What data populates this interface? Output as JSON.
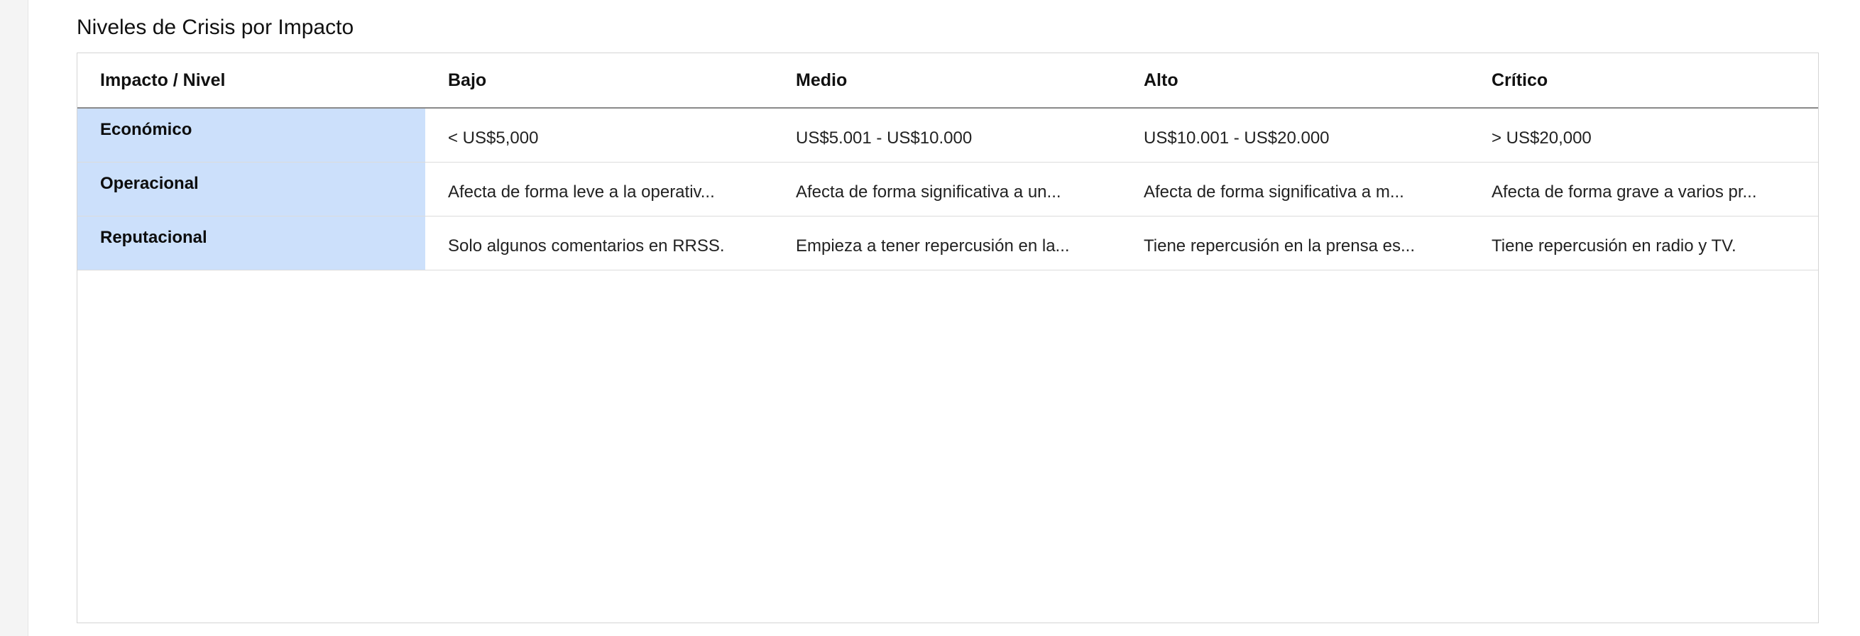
{
  "page": {
    "title": "Niveles de Crisis por Impacto"
  },
  "table": {
    "headers": [
      "Impacto / Nivel",
      "Bajo",
      "Medio",
      "Alto",
      "Crítico"
    ],
    "rows": [
      {
        "label": "Económico",
        "cells": [
          "< US$5,000",
          "US$5.001 - US$10.000",
          "US$10.001 - US$20.000",
          "> US$20,000"
        ]
      },
      {
        "label": "Operacional",
        "cells": [
          "Afecta de forma leve a la operativ...",
          "Afecta de forma significativa a un...",
          "Afecta de forma significativa a m...",
          "Afecta de forma grave a varios pr..."
        ]
      },
      {
        "label": "Reputacional",
        "cells": [
          "Solo algunos comentarios en RRSS.",
          "Empieza a tener repercusión en la...",
          "Tiene repercusión en la prensa es...",
          "Tiene repercusión en radio y TV."
        ]
      }
    ]
  },
  "colors": {
    "row_header_bg": "#cce0fb",
    "border": "#d4d4d4"
  }
}
